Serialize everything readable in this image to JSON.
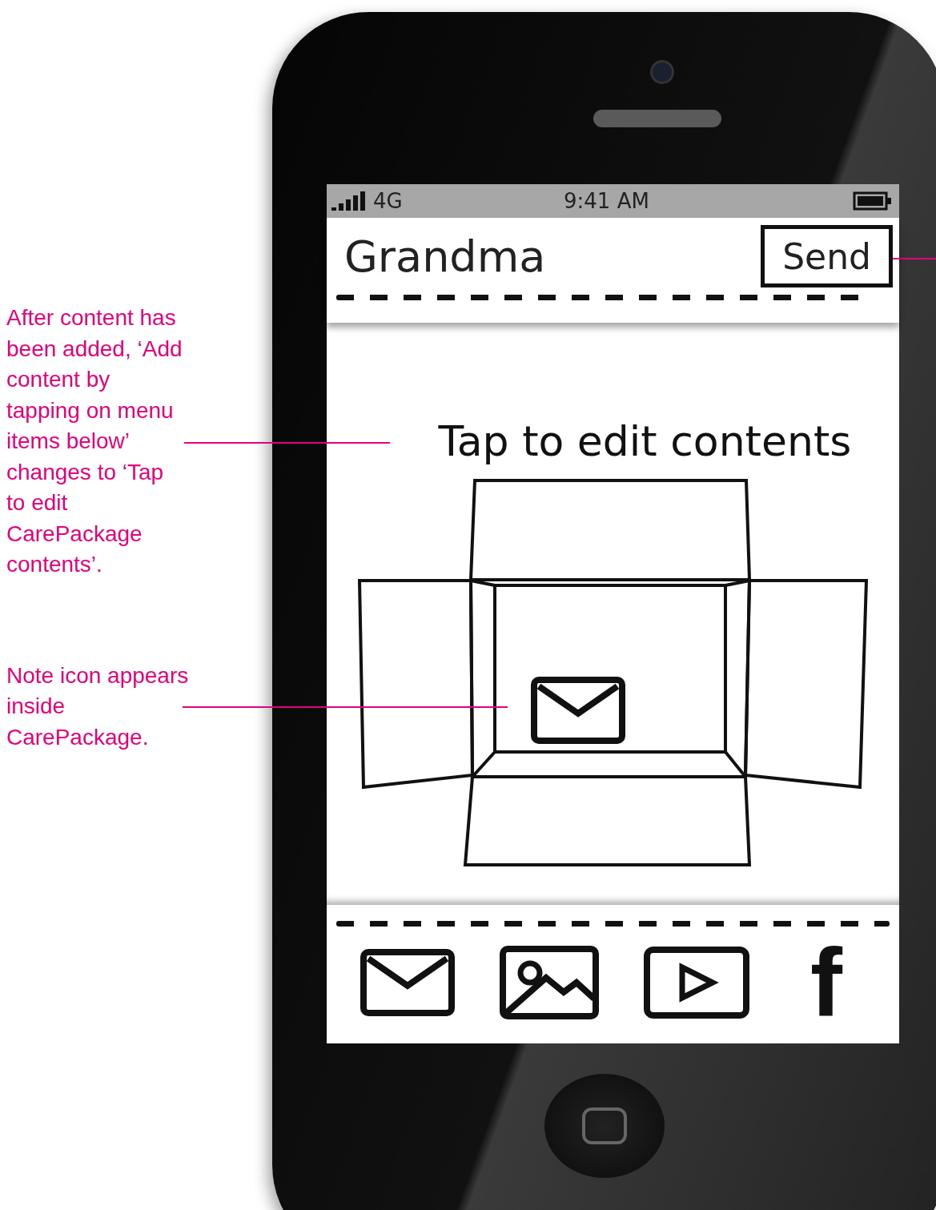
{
  "status_bar": {
    "network": "4G",
    "time": "9:41 AM"
  },
  "header": {
    "title": "Grandma",
    "send_button": "Send"
  },
  "content": {
    "prompt": "Tap to edit contents"
  },
  "toolbar": {
    "letter_item": "f"
  },
  "annotations": [
    {
      "text": "After content has been added, ‘Add content by tapping on menu items below’ changes to ‘Tap to edit CarePackage contents’."
    },
    {
      "text": "Note icon appears inside CarePackage."
    }
  ]
}
